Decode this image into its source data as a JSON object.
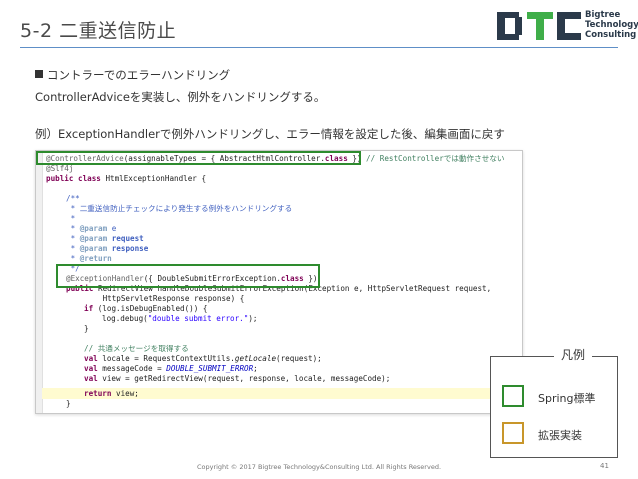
{
  "slide": {
    "title": "5-2 二重送信防止",
    "bullet": "コントラーでのエラーハンドリング",
    "line1": "ControllerAdviceを実装し、例外をハンドリングする。",
    "example": "例）ExceptionHandlerで例外ハンドリングし、エラー情報を設定した後、編集画面に戻す"
  },
  "logo": {
    "line1": "Bigtree",
    "line2": "Technology",
    "line3": "Consulting"
  },
  "code": {
    "l1_ann": "@ControllerAdvice",
    "l1_rest": "(assignableTypes = { AbstractHtmlController.",
    "l1_kw": "class",
    "l1_end": " })",
    "l1_comment": " // RestControllerでは動作させない",
    "l2": "@Slf4j",
    "l3_kw": "public class",
    "l3_rest": " HtmlExceptionHandler {",
    "l5": "/**",
    "l6": " * 二重送信防止チェックにより発生する例外をハンドリングする",
    "l7": " *",
    "l8_tag": "@param",
    "l8_val": " e",
    "l9_tag": "@param",
    "l9_val": " request",
    "l10_tag": "@param",
    "l10_val": " response",
    "l11_tag": "@return",
    "l12": " */",
    "l13_ann": "@ExceptionHandler",
    "l13_rest": "({ DoubleSubmitErrorException.",
    "l13_kw": "class",
    "l13_end": " })",
    "l14_kw": "public",
    "l14_rest": " RedirectView handleDoubleSubmitErrorException(Exception e, HttpServletRequest request,",
    "l15": "        HttpServletResponse response) {",
    "l16_kw": "if",
    "l16_rest": " (log.isDebugEnabled()) {",
    "l17_a": "log.debug(",
    "l17_str": "\"double submit error.\"",
    "l17_b": ");",
    "l18": "}",
    "l20": "// 共通メッセージを取得する",
    "l21_kw": "val",
    "l21_a": " locale = RequestContextUtils.",
    "l21_it": "getLocale",
    "l21_b": "(request);",
    "l22_kw": "val",
    "l22_a": " messageCode = ",
    "l22_fld": "DOUBLE_SUBMIT_ERROR",
    "l22_b": ";",
    "l23_kw": "val",
    "l23_a": " view = getRedirectView(request, response, locale, messageCode);",
    "l25_kw": "return",
    "l25_a": " view;",
    "l26": "}"
  },
  "legend": {
    "title": "凡例",
    "spring": "Spring標準",
    "ext": "拡張実装",
    "spring_color": "#2e8b2e",
    "ext_color": "#c8962a"
  },
  "footer": {
    "copyright": "Copyright © 2017 Bigtree Technology&Consulting Ltd. All Rights Reserved.",
    "page": "41"
  }
}
